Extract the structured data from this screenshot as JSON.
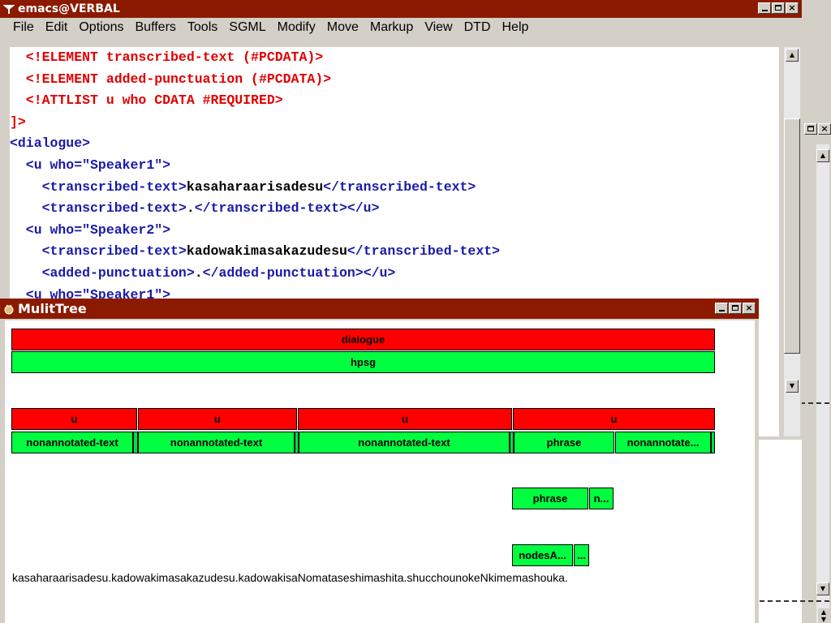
{
  "emacs": {
    "title": "emacs@VERBAL",
    "menu": [
      "File",
      "Edit",
      "Options",
      "Buffers",
      "Tools",
      "SGML",
      "Modify",
      "Move",
      "Markup",
      "View",
      "DTD",
      "Help"
    ],
    "lines": [
      [
        {
          "t": "  <!ELEMENT transcribed-text (#PCDATA)>",
          "c": "red"
        }
      ],
      [
        {
          "t": "  <!ELEMENT added-punctuation (#PCDATA)>",
          "c": "red"
        }
      ],
      [
        {
          "t": "  <!ATTLIST u who CDATA #REQUIRED>",
          "c": "red"
        }
      ],
      [
        {
          "t": "]>",
          "c": "red"
        }
      ],
      [
        {
          "t": "<dialogue>",
          "c": "blue"
        }
      ],
      [
        {
          "t": "  <u who=\"Speaker1\">",
          "c": "blue"
        }
      ],
      [
        {
          "t": "    <transcribed-text>",
          "c": "blue"
        },
        {
          "t": "kasaharaarisadesu",
          "c": "blk"
        },
        {
          "t": "</transcribed-text>",
          "c": "blue"
        }
      ],
      [
        {
          "t": "    <transcribed-text>",
          "c": "blue"
        },
        {
          "t": ".",
          "c": "blk"
        },
        {
          "t": "</transcribed-text></u>",
          "c": "blue"
        }
      ],
      [
        {
          "t": "  <u who=\"Speaker2\">",
          "c": "blue"
        }
      ],
      [
        {
          "t": "    <transcribed-text>",
          "c": "blue"
        },
        {
          "t": "kadowakimasakazudesu",
          "c": "blk"
        },
        {
          "t": "</transcribed-text>",
          "c": "blue"
        }
      ],
      [
        {
          "t": "    <added-punctuation>",
          "c": "blue"
        },
        {
          "t": ".",
          "c": "blk"
        },
        {
          "t": "</added-punctuation></u>",
          "c": "blue"
        }
      ],
      [
        {
          "t": "  <u who=\"Speaker1\">",
          "c": "blue"
        }
      ]
    ]
  },
  "mtree": {
    "title": "MulitTree",
    "nodes": {
      "dialogue": "dialogue",
      "hpsg": "hpsg",
      "u1": "u",
      "u2": "u",
      "u3": "u",
      "u4": "u",
      "nt1": "nonannotated-text",
      "nt2": "nonannotated-text",
      "nt3": "nonannotated-text",
      "phrase1": "phrase",
      "nt4": "nonannotate...",
      "phrase2": "phrase",
      "n2": "n...",
      "nodesA": "nodesA...",
      "dots": "..."
    },
    "sentence": "kasaharaarisadesu.kadowakimasakazudesu.kadowakisaNomataseshimashita.shucchounokeNkimemashouka."
  },
  "colors": {
    "titlebar": "#8b1a00",
    "node_red": "#ff0000",
    "node_green": "#00ff40",
    "dtd_red": "#e00000",
    "tag_blue": "#1a1aaa"
  }
}
